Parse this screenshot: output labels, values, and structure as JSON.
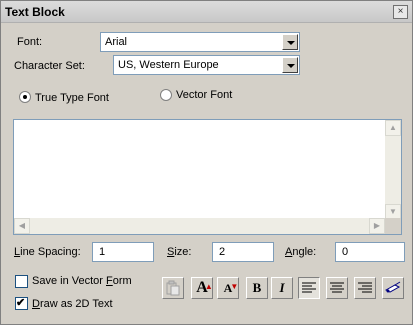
{
  "window": {
    "title": "Text Block",
    "close_glyph": "×"
  },
  "font": {
    "label": "Font:",
    "value": "Arial"
  },
  "charset": {
    "label": "Character Set:",
    "value": "US, Western Europe"
  },
  "font_type": {
    "options": [
      {
        "label": "True Type Font",
        "selected": true
      },
      {
        "label": "Vector Font",
        "selected": false
      }
    ]
  },
  "text_area": {
    "value": ""
  },
  "line_spacing": {
    "label_underlined": "L",
    "label_rest": "ine Spacing:",
    "value": "1"
  },
  "size": {
    "label_underlined": "S",
    "label_rest": "ize:",
    "value": "2"
  },
  "angle": {
    "label_underlined": "A",
    "label_rest": "ngle:",
    "value": "0"
  },
  "options": {
    "save_vector": {
      "label_pre": "Save in Vector ",
      "label_underlined": "F",
      "label_post": "orm",
      "checked": false
    },
    "draw_2d": {
      "label_pre": "",
      "label_underlined": "D",
      "label_post": "raw as 2D Text",
      "checked": true
    }
  },
  "toolbar": {
    "bold": "B",
    "italic": "I",
    "grow_font": "A",
    "shrink_font": "A",
    "buttons": [
      "paste-icon",
      "grow-font-icon",
      "shrink-font-icon",
      "bold-icon",
      "italic-icon",
      "align-left-icon",
      "align-center-icon",
      "align-right-icon",
      "pick-icon"
    ]
  }
}
